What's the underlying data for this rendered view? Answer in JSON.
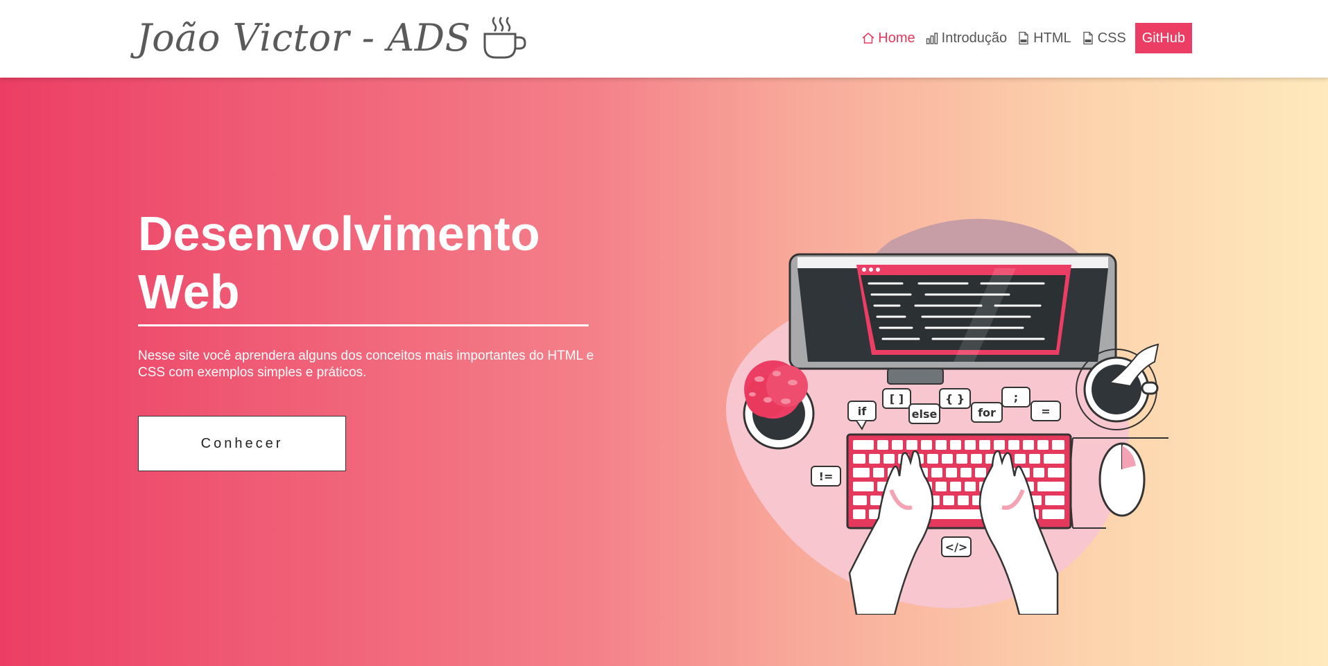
{
  "brand": {
    "name": "João Victor - ADS",
    "icon": "coffee-cup-icon"
  },
  "nav": {
    "items": [
      {
        "label": "Home",
        "icon": "home-icon",
        "active": true
      },
      {
        "label": "Introdução",
        "icon": "bar-chart-icon",
        "active": false
      },
      {
        "label": "HTML",
        "icon": "html-file-icon",
        "active": false
      },
      {
        "label": "CSS",
        "icon": "css-file-icon",
        "active": false
      }
    ],
    "github_label": "GitHub"
  },
  "hero": {
    "title_line1": "Desenvolvimento",
    "title_line2": "Web",
    "description": "Nesse site você aprendera alguns dos conceitos mais importantes do HTML e CSS com exemplos simples e práticos.",
    "button_label": "Conhecer",
    "illustration": "developer-typing-illustration",
    "bubbles": [
      "if",
      "[ ]",
      "else",
      "{ }",
      "for",
      ";",
      "=",
      "!=",
      "</>"
    ]
  },
  "colors": {
    "accent": "#ec3e64",
    "gradient_start": "#ec3e64",
    "gradient_end": "#ffe9bd",
    "nav_text": "#555555"
  }
}
